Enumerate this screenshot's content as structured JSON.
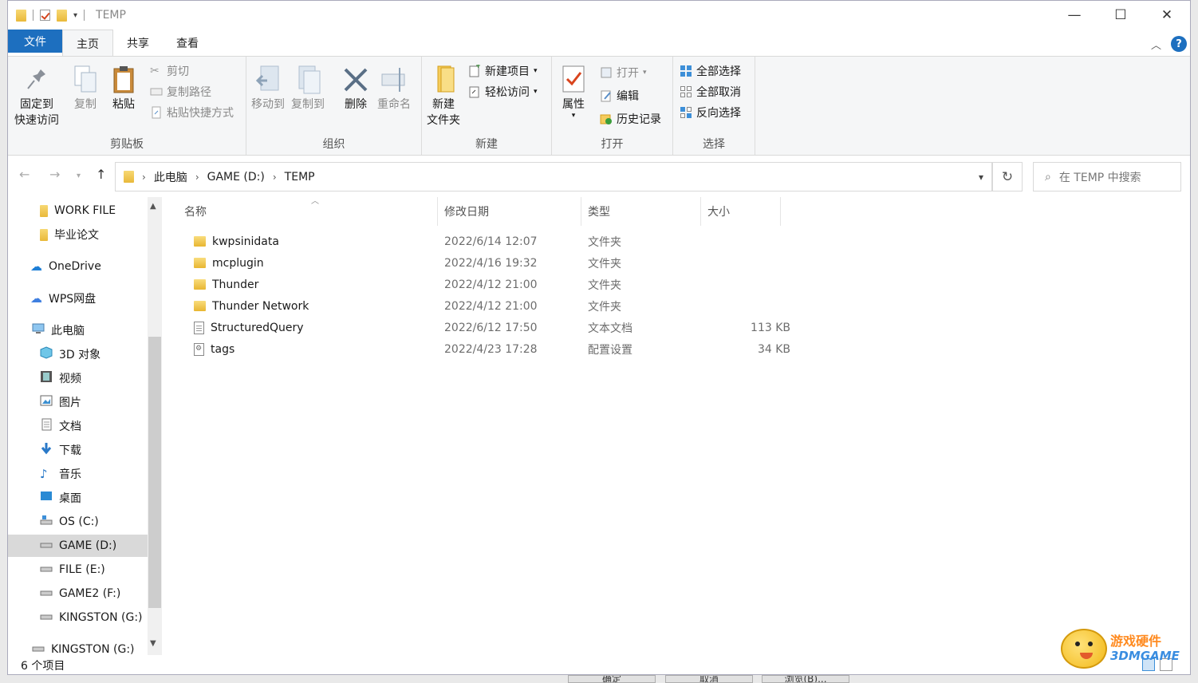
{
  "window": {
    "title": "TEMP",
    "controls": {
      "minimize": "—",
      "maximize": "☐",
      "close": "✕"
    }
  },
  "tabs": [
    {
      "label": "文件"
    },
    {
      "label": "主页"
    },
    {
      "label": "共享"
    },
    {
      "label": "查看"
    }
  ],
  "ribbon": {
    "clipboard": {
      "label": "剪贴板",
      "pin": "固定到\n快速访问",
      "pin_l1": "固定到",
      "pin_l2": "快速访问",
      "copy": "复制",
      "paste": "粘贴",
      "cut": "剪切",
      "copy_path": "复制路径",
      "paste_shortcut": "粘贴快捷方式"
    },
    "organize": {
      "label": "组织",
      "move_to": "移动到",
      "copy_to": "复制到",
      "delete": "删除",
      "rename": "重命名"
    },
    "new": {
      "label": "新建",
      "new_folder_l1": "新建",
      "new_folder_l2": "文件夹",
      "new_item": "新建项目",
      "easy_access": "轻松访问"
    },
    "open": {
      "label": "打开",
      "properties": "属性",
      "open": "打开",
      "edit": "编辑",
      "history": "历史记录"
    },
    "select": {
      "label": "选择",
      "select_all": "全部选择",
      "select_none": "全部取消",
      "invert": "反向选择"
    }
  },
  "address": {
    "crumbs": [
      "此电脑",
      "GAME (D:)",
      "TEMP"
    ],
    "search_placeholder": "在 TEMP 中搜索"
  },
  "nav": {
    "items": [
      {
        "label": "WORK FILE",
        "icon": "folder-icon"
      },
      {
        "label": "毕业论文",
        "icon": "folder-icon"
      },
      {
        "label": "OneDrive",
        "icon": "cloud-icon"
      },
      {
        "label": "WPS网盘",
        "icon": "cloud-icon"
      },
      {
        "label": "此电脑",
        "icon": "computer-icon"
      },
      {
        "label": "3D 对象",
        "icon": "cube-icon"
      },
      {
        "label": "视频",
        "icon": "video-icon"
      },
      {
        "label": "图片",
        "icon": "picture-icon"
      },
      {
        "label": "文档",
        "icon": "document-icon"
      },
      {
        "label": "下载",
        "icon": "download-icon"
      },
      {
        "label": "音乐",
        "icon": "music-icon"
      },
      {
        "label": "桌面",
        "icon": "desktop-icon"
      },
      {
        "label": "OS (C:)",
        "icon": "drive-icon"
      },
      {
        "label": "GAME (D:)",
        "icon": "drive-icon"
      },
      {
        "label": "FILE (E:)",
        "icon": "drive-icon"
      },
      {
        "label": "GAME2 (F:)",
        "icon": "drive-icon"
      },
      {
        "label": "KINGSTON (G:)",
        "icon": "drive-icon"
      },
      {
        "label": "KINGSTON (G:)",
        "icon": "drive-icon"
      }
    ]
  },
  "list": {
    "columns": {
      "name": "名称",
      "date": "修改日期",
      "type": "类型",
      "size": "大小"
    },
    "rows": [
      {
        "name": "kwpsinidata",
        "date": "2022/6/14 12:07",
        "type": "文件夹",
        "size": ""
      },
      {
        "name": "mcplugin",
        "date": "2022/4/16 19:32",
        "type": "文件夹",
        "size": ""
      },
      {
        "name": "Thunder",
        "date": "2022/4/12 21:00",
        "type": "文件夹",
        "size": ""
      },
      {
        "name": "Thunder Network",
        "date": "2022/4/12 21:00",
        "type": "文件夹",
        "size": ""
      },
      {
        "name": "StructuredQuery",
        "date": "2022/6/12 17:50",
        "type": "文本文档",
        "size": "113 KB"
      },
      {
        "name": "tags",
        "date": "2022/4/23 17:28",
        "type": "配置设置",
        "size": "34 KB"
      }
    ]
  },
  "status": {
    "count": "6 个项目"
  },
  "underlying_buttons": [
    "确定",
    "取消",
    "浏览(B)..."
  ],
  "watermark": {
    "line1": "游戏硬件",
    "line2": "3DMGAME"
  },
  "colors": {
    "accent": "#1d6fbf",
    "selected": "#d9d9d9",
    "folder": "#e8b631"
  }
}
